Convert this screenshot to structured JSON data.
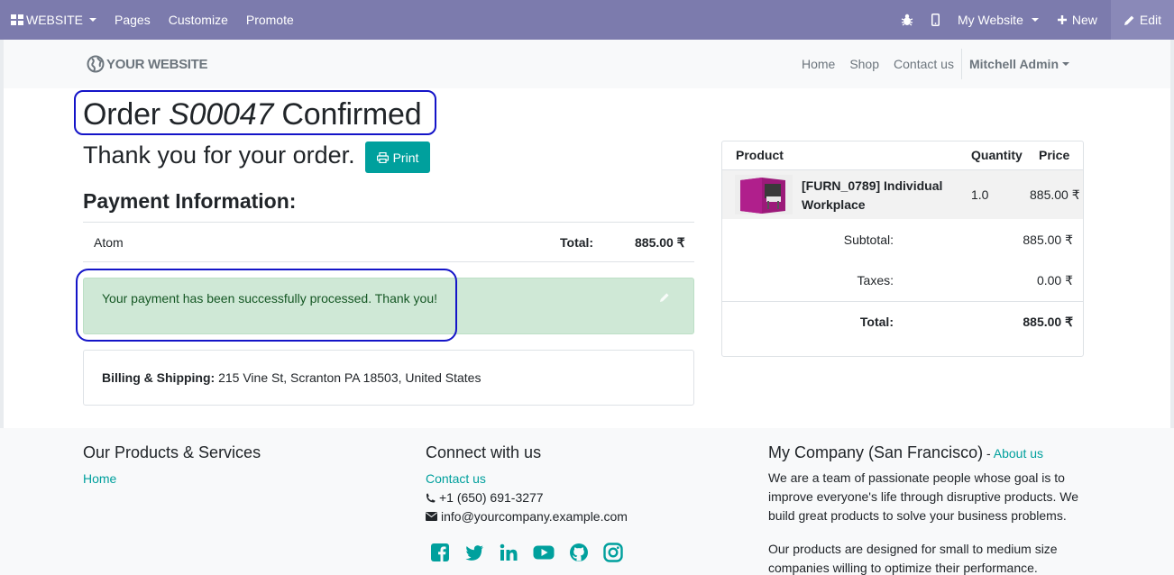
{
  "editbar": {
    "website_label": "WEBSITE",
    "pages": "Pages",
    "customize": "Customize",
    "promote": "Promote",
    "my_website": "My Website",
    "new": "New",
    "edit": "Edit"
  },
  "header": {
    "logo_text": "YOUR WEBSITE",
    "nav": [
      "Home",
      "Shop",
      "Contact us"
    ],
    "user": "Mitchell Admin"
  },
  "order": {
    "title_prefix": "Order ",
    "order_ref": "S00047",
    "title_suffix": " Confirmed",
    "thanks": "Thank you for your order.",
    "print_label": "Print"
  },
  "payment": {
    "heading": "Payment Information:",
    "method": "Atom",
    "total_label": "Total:",
    "total_value": "885.00 ₹",
    "success_message": "Your payment has been successfully processed. Thank you!"
  },
  "billing": {
    "label": "Billing & Shipping:",
    "address": " 215 Vine St, Scranton PA 18503, United States"
  },
  "summary": {
    "col_product": "Product",
    "col_quantity": "Quantity",
    "col_price": "Price",
    "product_name": "[FURN_0789] Individual Workplace",
    "quantity": "1.0",
    "price": "885.00 ₹",
    "subtotal_label": "Subtotal:",
    "subtotal_value": "885.00 ₹",
    "taxes_label": "Taxes:",
    "taxes_value": "0.00 ₹",
    "total_label": "Total:",
    "total_value": "885.00 ₹"
  },
  "footer": {
    "col1_heading": "Our Products & Services",
    "col1_link": "Home",
    "col2_heading": "Connect with us",
    "contact_link": "Contact us",
    "phone": "+1 (650) 691-3277",
    "email": "info@yourcompany.example.com",
    "col3_heading": "My Company (San Francisco)",
    "col3_sep": " - ",
    "about_link": "About us",
    "para1": "We are a team of passionate people whose goal is to improve everyone's life through disruptive products. We build great products to solve your business problems.",
    "para2": "Our products are designed for small to medium size companies willing to optimize their performance.",
    "social_icons": [
      "facebook-icon",
      "twitter-icon",
      "linkedin-icon",
      "youtube-icon",
      "github-icon",
      "instagram-icon"
    ]
  },
  "colors": {
    "editbar": "#7c7bad",
    "accent": "#00a09d",
    "alert_bg": "#cfe8d6",
    "highlight": "#1414c8"
  }
}
